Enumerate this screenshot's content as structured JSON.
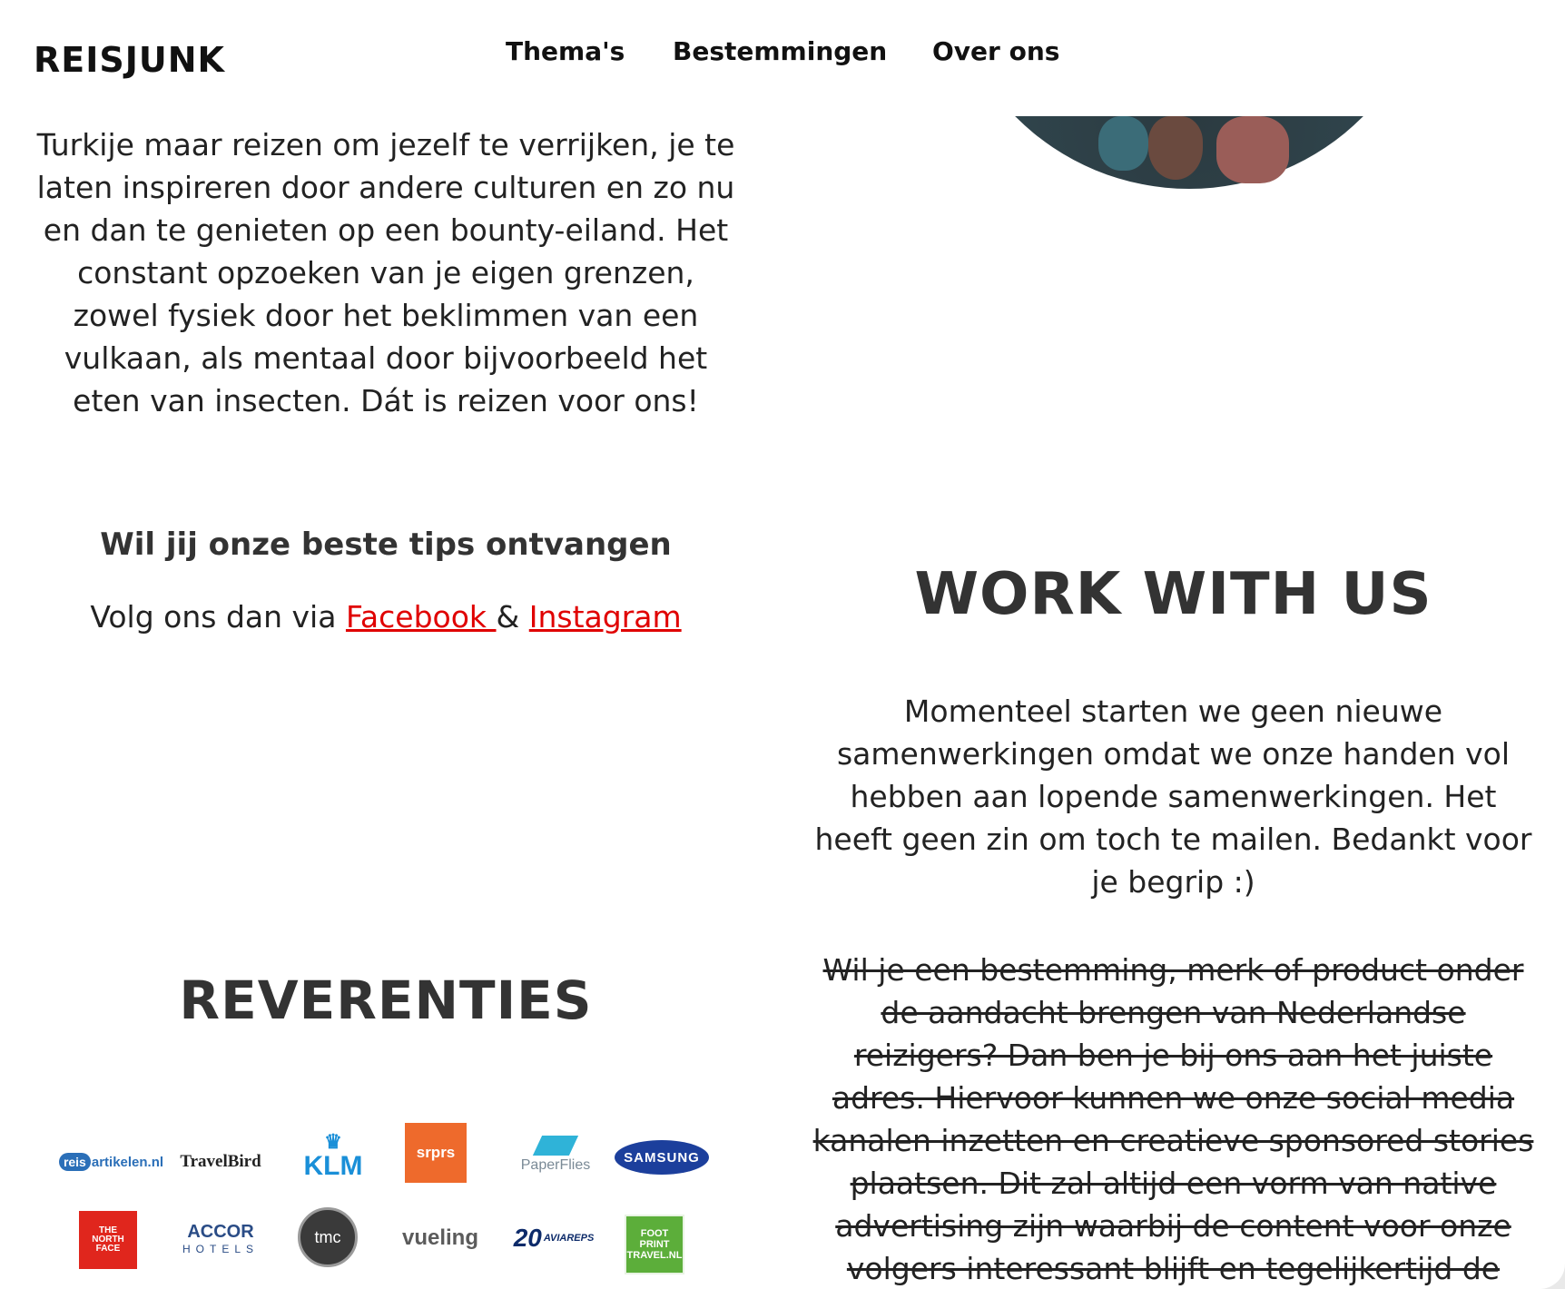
{
  "header": {
    "logo": "REISJUNK",
    "nav": [
      "Thema's",
      "Bestemmingen",
      "Over ons"
    ]
  },
  "intro": {
    "partial_line": "Turkije maar reizen om jezelf te verrijken, je te",
    "text": "Turkije maar reizen om jezelf te verrijken, je te laten inspireren door andere culturen en zo nu en dan te genieten op een bounty-eiland. Het constant opzoeken van je eigen grenzen, zowel fysiek door het beklimmen van een vulkaan, als mentaal door bijvoorbeeld het eten van insecten. Dát is reizen voor ons!"
  },
  "tips": {
    "title": "Wil jij onze beste tips ontvangen",
    "prefix": "Volg ons dan via ",
    "facebook": "Facebook ",
    "ampersand": "& ",
    "instagram": "Instagram"
  },
  "references": {
    "title": "REVERENTIES",
    "logos": [
      "reisartikelen.nl",
      "TravelBird",
      "KLM",
      "srprs",
      "PaperFlies",
      "SAMSUNG",
      "THE NORTH FACE",
      "ACCOR HOTELS",
      "tmc",
      "vueling",
      "20 AVIAREPS",
      "FOOT PRINT TRAVEL.NL"
    ]
  },
  "work": {
    "title": "WORK WITH US",
    "text": "Momenteel starten we geen nieuwe samenwerkingen omdat we onze handen vol hebben aan lopende samenwerkingen. Het heeft geen zin om toch te mailen. Bedankt voor je begrip :)",
    "struck_text": "Wil je een bestemming, merk of product onder de aandacht brengen van Nederlandse reizigers? Dan ben je bij ons aan het juiste adres. Hiervoor kunnen we onze social media kanalen inzetten en creatieve sponsored stories plaatsen. Dit zal altijd een vorm van native advertising zijn waarbij de content voor onze volgers interessant blijft en tegelijkertijd de"
  },
  "colors": {
    "link": "#e00000",
    "heading": "#333333",
    "background": "#ffffff"
  }
}
